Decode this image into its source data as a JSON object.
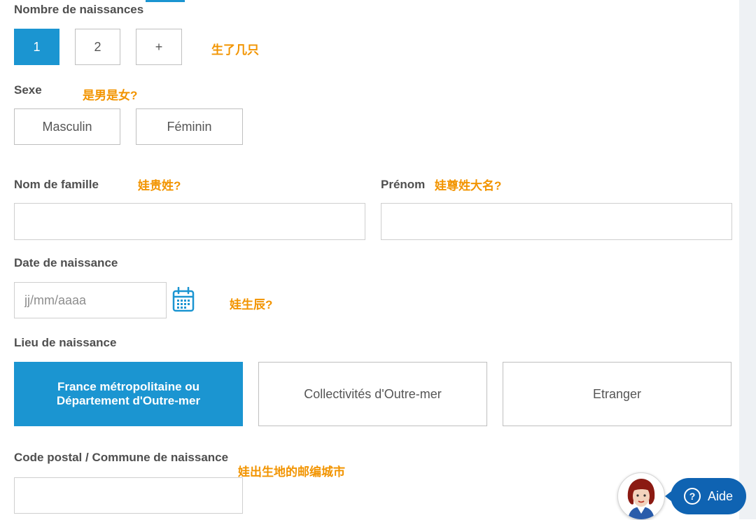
{
  "births": {
    "label": "Nombre de naissances",
    "options": [
      "1",
      "2",
      "+"
    ],
    "selected": "1",
    "note": "生了几只"
  },
  "sex": {
    "label": "Sexe",
    "note": "是男是女?",
    "options": [
      "Masculin",
      "Féminin"
    ]
  },
  "last_name": {
    "label": "Nom de famille",
    "note": "娃贵姓?",
    "value": ""
  },
  "first_name": {
    "label": "Prénom",
    "note": "娃尊姓大名?",
    "value": ""
  },
  "birth_date": {
    "label": "Date de naissance",
    "placeholder": "jj/mm/aaaa",
    "note": "娃生辰?",
    "icon": "calendar-icon"
  },
  "birth_place": {
    "label": "Lieu de naissance",
    "options": [
      {
        "line1": "France métropolitaine ou",
        "line2": "Département d'Outre-mer"
      },
      {
        "text": "Collectivités d'Outre-mer"
      },
      {
        "text": "Etranger"
      }
    ],
    "selected_index": 0
  },
  "postal": {
    "label": "Code postal / Commune de naissance",
    "note": "娃出生地的邮编城市",
    "value": ""
  },
  "help": {
    "label": "Aide",
    "icon": "question-circle-icon",
    "avatar": "assistant-avatar"
  },
  "colors": {
    "accent": "#1b95d1",
    "note": "#f29400",
    "help": "#0f63b2",
    "border": "#bfbfbf"
  }
}
